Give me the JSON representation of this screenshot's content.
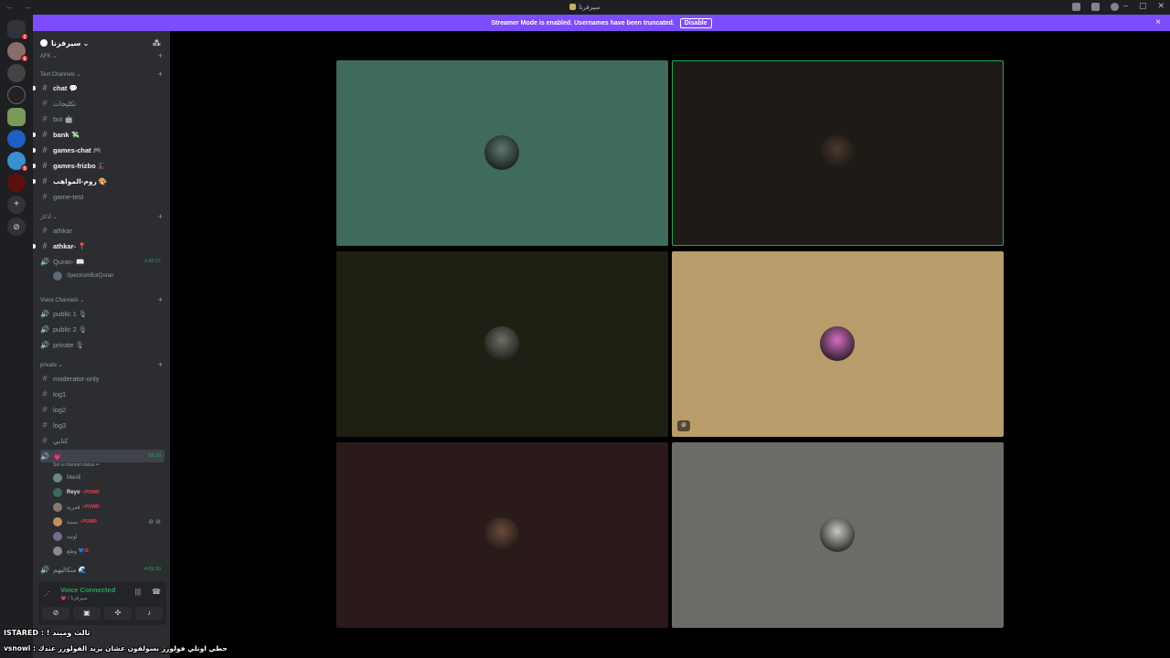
{
  "titlebar": {
    "title": "سيرفرنا",
    "nav": "← →"
  },
  "banner": {
    "message": "Streamer Mode is enabled. Usernames have been truncated.",
    "disable_label": "Disable",
    "close": "×"
  },
  "sidebar": {
    "server_name": "سيرفرنا",
    "afk_label": "AFK",
    "categories": {
      "text": "Text Channels",
      "athkar": "أذكار",
      "voice": "Voice Channels",
      "private": "private"
    },
    "text_channels": [
      {
        "name": "chat 💬",
        "unread": true
      },
      {
        "name": "تكليجات",
        "unread": false
      },
      {
        "name": "bot 🤖",
        "unread": false
      },
      {
        "name": "bank 💸",
        "unread": true
      },
      {
        "name": "games-chat 🎮",
        "unread": true
      },
      {
        "name": "games-frizbo 🎩",
        "unread": true
      },
      {
        "name": "روم-المواهب 🎨",
        "unread": true
      },
      {
        "name": "game-test",
        "unread": false
      }
    ],
    "athkar_channels": [
      {
        "name": "athkar",
        "unread": false
      },
      {
        "name": "athkar- 📍",
        "unread": true
      }
    ],
    "quran_channel": {
      "name": "Quran- 📖",
      "time": "1:42:27"
    },
    "quran_user": "SpectrumBotQuran",
    "voice_channels": [
      "public 1 🎙",
      "public 2 🎙",
      "private 🎙"
    ],
    "private_channels": [
      "moderator-only",
      "log1",
      "log2",
      "log3",
      "كتابي"
    ],
    "active_voice": {
      "name": "💗",
      "time": "59:18",
      "status": "Set a channel status ✏"
    },
    "active_users": [
      {
        "name": "Mavili",
        "tag": "",
        "bold": false
      },
      {
        "name": "Reyo",
        "tag": "⚡POWR",
        "bold": true
      },
      {
        "name": "قمرية",
        "tag": "⚡POWR",
        "bold": false
      },
      {
        "name": "مبنية",
        "tag": "⚡POWR",
        "bold": false
      },
      {
        "name": "لونية",
        "tag": "",
        "bold": false
      },
      {
        "name": "وطع",
        "tag": "💙IS",
        "bold": false
      }
    ],
    "other_voice": {
      "name": "سكاليهم 🌊",
      "time": "4:09:20"
    }
  },
  "voice_panel": {
    "title": "Voice Connected",
    "subtitle": "💗 / سيرفرنا"
  },
  "overlay": {
    "line1": "ISTARED : ! ثالث ومبند",
    "line2": "vsnowi : حطي اونلي فولورز بسولفون عشان يزيد الفولورز عندك"
  },
  "tiles": [
    {
      "bg": "#3f6b5a",
      "avatar": "#5d7a6e",
      "speaking": false
    },
    {
      "bg": "#1e1b17",
      "avatar": "#4a3a2c",
      "speaking": true
    },
    {
      "bg": "#1f1f14",
      "avatar": "#6f6f66",
      "speaking": false
    },
    {
      "bg": "#b89d6a",
      "avatar": "#d46fc1",
      "speaking": false
    },
    {
      "bg": "#2a1a1a",
      "avatar": "#6b4a3a",
      "speaking": false
    },
    {
      "bg": "#6d6b66",
      "avatar": "#c9c7c2",
      "speaking": false
    }
  ]
}
